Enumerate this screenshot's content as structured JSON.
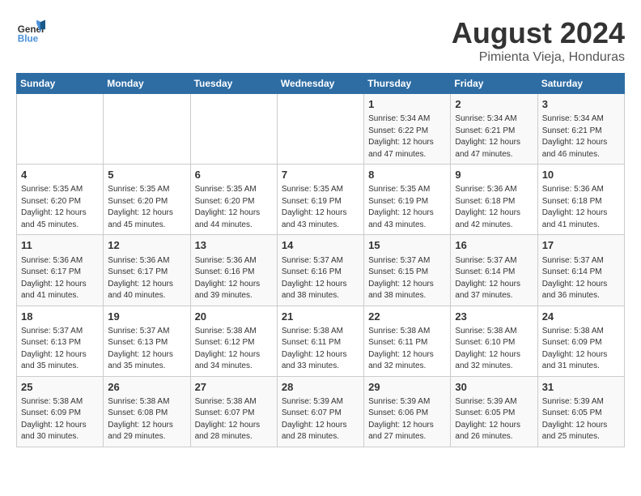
{
  "header": {
    "logo_general": "General",
    "logo_blue": "Blue",
    "title": "August 2024",
    "location": "Pimienta Vieja, Honduras"
  },
  "days_of_week": [
    "Sunday",
    "Monday",
    "Tuesday",
    "Wednesday",
    "Thursday",
    "Friday",
    "Saturday"
  ],
  "weeks": [
    [
      {
        "day": "",
        "info": ""
      },
      {
        "day": "",
        "info": ""
      },
      {
        "day": "",
        "info": ""
      },
      {
        "day": "",
        "info": ""
      },
      {
        "day": "1",
        "info": "Sunrise: 5:34 AM\nSunset: 6:22 PM\nDaylight: 12 hours\nand 47 minutes."
      },
      {
        "day": "2",
        "info": "Sunrise: 5:34 AM\nSunset: 6:21 PM\nDaylight: 12 hours\nand 47 minutes."
      },
      {
        "day": "3",
        "info": "Sunrise: 5:34 AM\nSunset: 6:21 PM\nDaylight: 12 hours\nand 46 minutes."
      }
    ],
    [
      {
        "day": "4",
        "info": "Sunrise: 5:35 AM\nSunset: 6:20 PM\nDaylight: 12 hours\nand 45 minutes."
      },
      {
        "day": "5",
        "info": "Sunrise: 5:35 AM\nSunset: 6:20 PM\nDaylight: 12 hours\nand 45 minutes."
      },
      {
        "day": "6",
        "info": "Sunrise: 5:35 AM\nSunset: 6:20 PM\nDaylight: 12 hours\nand 44 minutes."
      },
      {
        "day": "7",
        "info": "Sunrise: 5:35 AM\nSunset: 6:19 PM\nDaylight: 12 hours\nand 43 minutes."
      },
      {
        "day": "8",
        "info": "Sunrise: 5:35 AM\nSunset: 6:19 PM\nDaylight: 12 hours\nand 43 minutes."
      },
      {
        "day": "9",
        "info": "Sunrise: 5:36 AM\nSunset: 6:18 PM\nDaylight: 12 hours\nand 42 minutes."
      },
      {
        "day": "10",
        "info": "Sunrise: 5:36 AM\nSunset: 6:18 PM\nDaylight: 12 hours\nand 41 minutes."
      }
    ],
    [
      {
        "day": "11",
        "info": "Sunrise: 5:36 AM\nSunset: 6:17 PM\nDaylight: 12 hours\nand 41 minutes."
      },
      {
        "day": "12",
        "info": "Sunrise: 5:36 AM\nSunset: 6:17 PM\nDaylight: 12 hours\nand 40 minutes."
      },
      {
        "day": "13",
        "info": "Sunrise: 5:36 AM\nSunset: 6:16 PM\nDaylight: 12 hours\nand 39 minutes."
      },
      {
        "day": "14",
        "info": "Sunrise: 5:37 AM\nSunset: 6:16 PM\nDaylight: 12 hours\nand 38 minutes."
      },
      {
        "day": "15",
        "info": "Sunrise: 5:37 AM\nSunset: 6:15 PM\nDaylight: 12 hours\nand 38 minutes."
      },
      {
        "day": "16",
        "info": "Sunrise: 5:37 AM\nSunset: 6:14 PM\nDaylight: 12 hours\nand 37 minutes."
      },
      {
        "day": "17",
        "info": "Sunrise: 5:37 AM\nSunset: 6:14 PM\nDaylight: 12 hours\nand 36 minutes."
      }
    ],
    [
      {
        "day": "18",
        "info": "Sunrise: 5:37 AM\nSunset: 6:13 PM\nDaylight: 12 hours\nand 35 minutes."
      },
      {
        "day": "19",
        "info": "Sunrise: 5:37 AM\nSunset: 6:13 PM\nDaylight: 12 hours\nand 35 minutes."
      },
      {
        "day": "20",
        "info": "Sunrise: 5:38 AM\nSunset: 6:12 PM\nDaylight: 12 hours\nand 34 minutes."
      },
      {
        "day": "21",
        "info": "Sunrise: 5:38 AM\nSunset: 6:11 PM\nDaylight: 12 hours\nand 33 minutes."
      },
      {
        "day": "22",
        "info": "Sunrise: 5:38 AM\nSunset: 6:11 PM\nDaylight: 12 hours\nand 32 minutes."
      },
      {
        "day": "23",
        "info": "Sunrise: 5:38 AM\nSunset: 6:10 PM\nDaylight: 12 hours\nand 32 minutes."
      },
      {
        "day": "24",
        "info": "Sunrise: 5:38 AM\nSunset: 6:09 PM\nDaylight: 12 hours\nand 31 minutes."
      }
    ],
    [
      {
        "day": "25",
        "info": "Sunrise: 5:38 AM\nSunset: 6:09 PM\nDaylight: 12 hours\nand 30 minutes."
      },
      {
        "day": "26",
        "info": "Sunrise: 5:38 AM\nSunset: 6:08 PM\nDaylight: 12 hours\nand 29 minutes."
      },
      {
        "day": "27",
        "info": "Sunrise: 5:38 AM\nSunset: 6:07 PM\nDaylight: 12 hours\nand 28 minutes."
      },
      {
        "day": "28",
        "info": "Sunrise: 5:39 AM\nSunset: 6:07 PM\nDaylight: 12 hours\nand 28 minutes."
      },
      {
        "day": "29",
        "info": "Sunrise: 5:39 AM\nSunset: 6:06 PM\nDaylight: 12 hours\nand 27 minutes."
      },
      {
        "day": "30",
        "info": "Sunrise: 5:39 AM\nSunset: 6:05 PM\nDaylight: 12 hours\nand 26 minutes."
      },
      {
        "day": "31",
        "info": "Sunrise: 5:39 AM\nSunset: 6:05 PM\nDaylight: 12 hours\nand 25 minutes."
      }
    ]
  ]
}
